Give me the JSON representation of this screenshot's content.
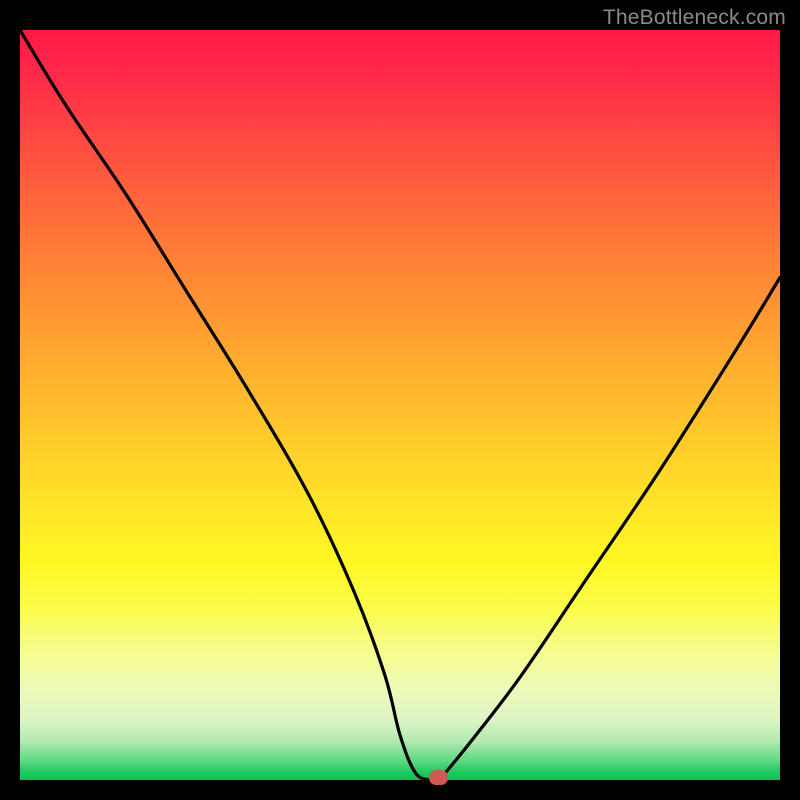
{
  "watermark": "TheBottleneck.com",
  "chart_data": {
    "type": "line",
    "title": "",
    "xlabel": "",
    "ylabel": "",
    "xlim": [
      0,
      100
    ],
    "ylim": [
      0,
      100
    ],
    "series": [
      {
        "name": "bottleneck-curve",
        "x": [
          0,
          6,
          14,
          22,
          30,
          38,
          44,
          48,
          50,
          52,
          54,
          55,
          56,
          60,
          66,
          74,
          84,
          94,
          100
        ],
        "y": [
          100,
          90,
          78,
          65,
          52,
          38,
          25,
          14,
          6,
          1,
          0,
          0,
          1,
          6,
          14,
          26,
          41,
          57,
          67
        ]
      }
    ],
    "marker": {
      "x": 55,
      "y": 0
    },
    "background": "red-yellow-green-vertical-gradient"
  },
  "colors": {
    "curve": "#000000",
    "marker": "#cc5a55",
    "background_top": "#ff1846",
    "background_bottom": "#0dc354"
  }
}
